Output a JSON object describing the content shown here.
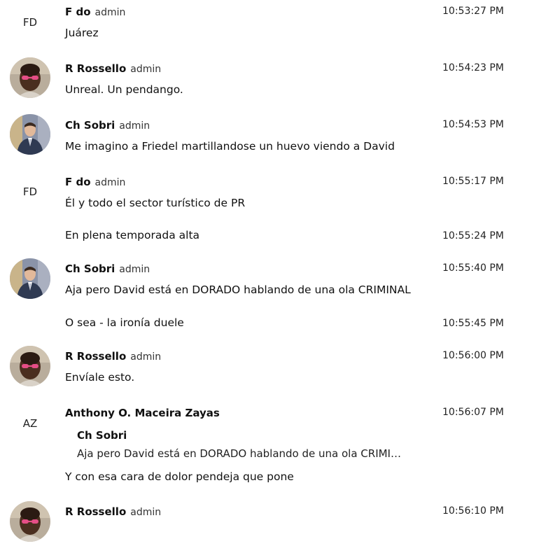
{
  "messages": [
    {
      "author": "F do",
      "role": "admin",
      "initials": "FD",
      "time": "10:53:27 PM",
      "text": "Juárez"
    },
    {
      "author": "R Rossello",
      "role": "admin",
      "time": "10:54:23 PM",
      "text": "Unreal. Un pendango."
    },
    {
      "author": "Ch Sobri",
      "role": "admin",
      "time": "10:54:53 PM",
      "text": "Me imagino a Friedel martillandose un huevo viendo a David"
    },
    {
      "author": "F do",
      "role": "admin",
      "initials": "FD",
      "time": "10:55:17 PM",
      "text": "Él y todo el sector turístico de PR"
    },
    {
      "continuation": true,
      "time": "10:55:24 PM",
      "text": "En plena temporada alta"
    },
    {
      "author": "Ch Sobri",
      "role": "admin",
      "time": "10:55:40 PM",
      "text": "Aja pero David está en DORADO hablando de una ola CRIMINAL"
    },
    {
      "continuation": true,
      "time": "10:55:45 PM",
      "text": "O sea - la ironía duele"
    },
    {
      "author": "R Rossello",
      "role": "admin",
      "time": "10:56:00 PM",
      "text": "Envíale esto."
    },
    {
      "author": "Anthony O. Maceira Zayas",
      "initials": "AZ",
      "time": "10:56:07 PM",
      "quote": {
        "author": "Ch Sobri",
        "text": "Aja pero David está en DORADO hablando de una ola CRIMI…"
      },
      "text": "Y con esa cara de dolor pendeja que pone"
    },
    {
      "author": "R Rossello",
      "role": "admin",
      "time": "10:56:10 PM"
    }
  ],
  "colors": {
    "background": "#ffffff",
    "text": "#111111"
  }
}
